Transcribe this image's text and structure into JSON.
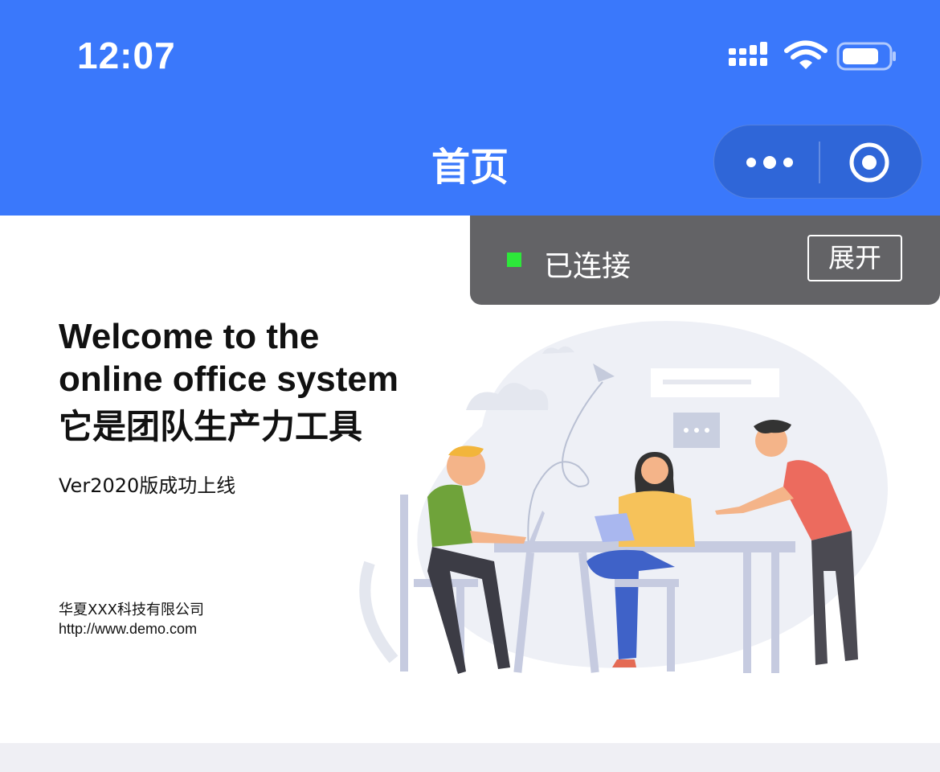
{
  "status_bar": {
    "time": "12:07"
  },
  "nav": {
    "title": "首页"
  },
  "connection": {
    "status": "已连接",
    "expand_label": "展开",
    "indicator_color": "#2de83a"
  },
  "banner": {
    "welcome_line1": "Welcome to the",
    "welcome_line2": "online office system",
    "slogan": "它是团队生产力工具",
    "version": "Ver2020版成功上线",
    "company": "华夏XXX科技有限公司",
    "website": "http://www.demo.com"
  },
  "colors": {
    "nav_blue": "#3a78fb",
    "panel_gray": "#636366",
    "page_bottom": "#efeff4"
  }
}
